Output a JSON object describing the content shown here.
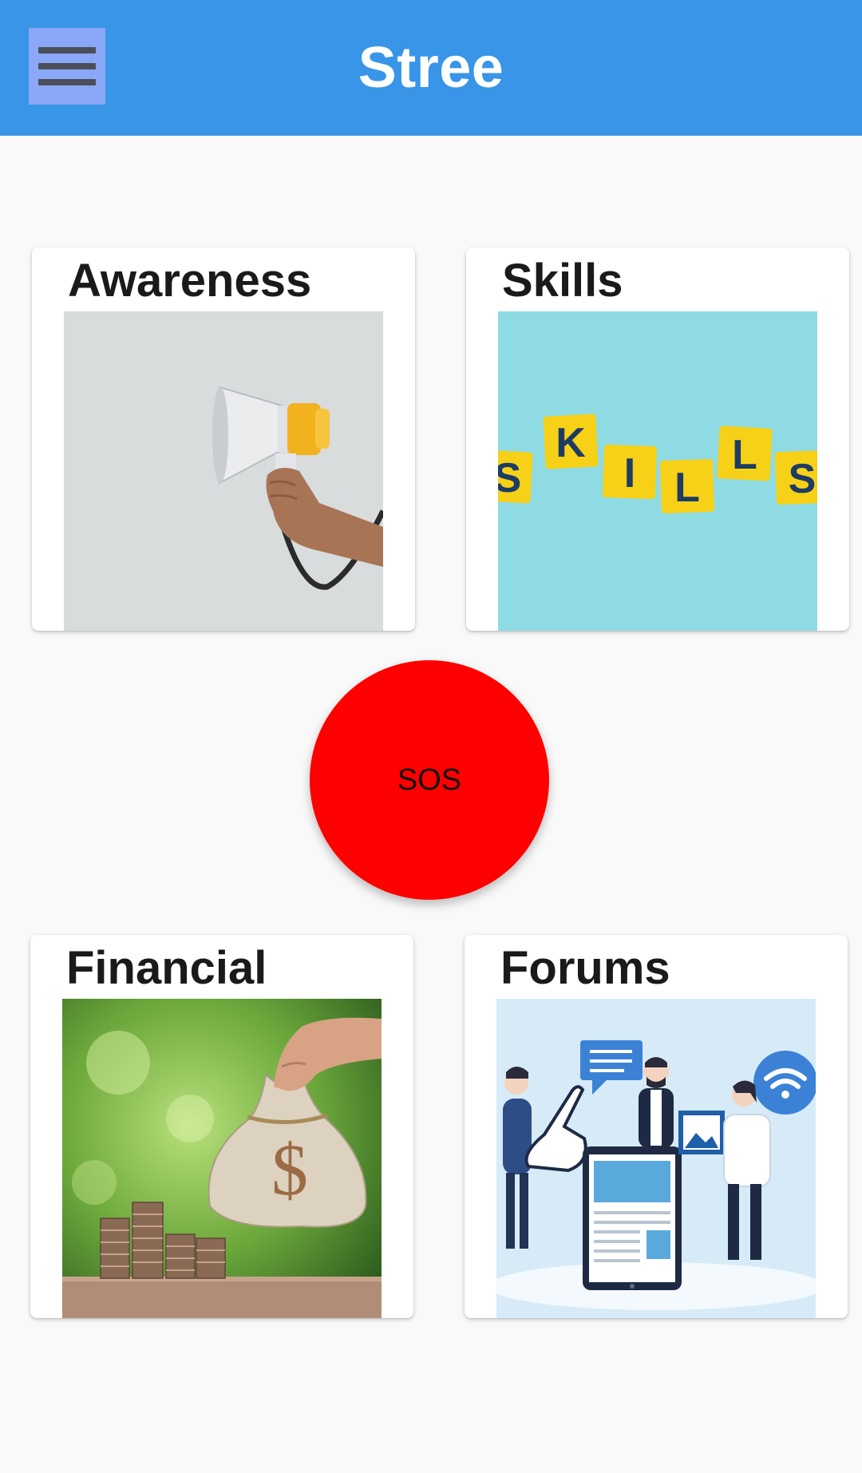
{
  "app_bar": {
    "title": "Stree",
    "menu_icon": "hamburger-menu-icon",
    "background": "#3895e8"
  },
  "cards": [
    {
      "title": "Awareness",
      "image": "megaphone-in-hand"
    },
    {
      "title": "Skills",
      "image": "skills-letter-tiles"
    },
    {
      "title": "Financial",
      "image": "money-bag-and-coin-stacks"
    },
    {
      "title": "Forums",
      "image": "people-discussion-illustration"
    }
  ],
  "sos": {
    "label": "SOS",
    "color": "#ff0000"
  },
  "skills_tiles": [
    "S",
    "K",
    "I",
    "L",
    "L",
    "S"
  ],
  "financial_symbol": "$"
}
